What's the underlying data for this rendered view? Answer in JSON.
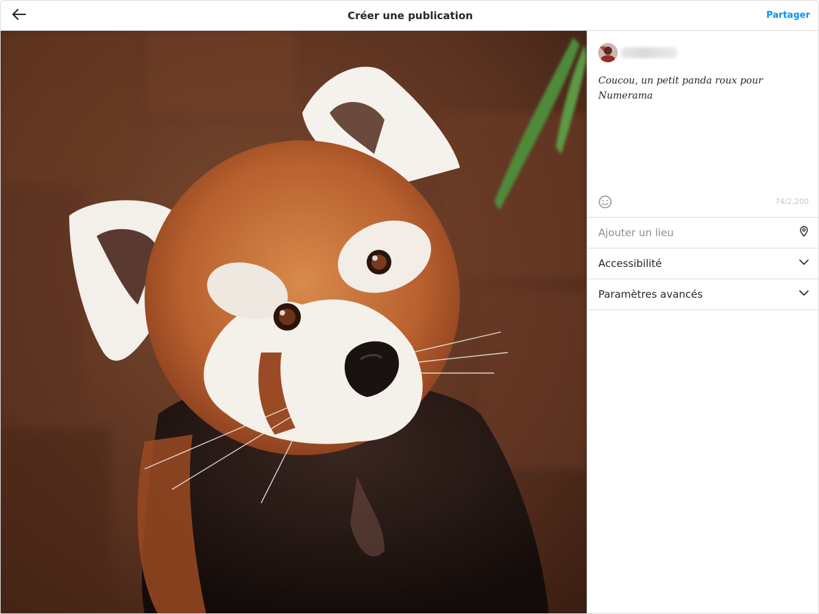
{
  "header": {
    "title": "Créer une publication",
    "share_label": "Partager",
    "back_icon": "arrow-left-icon"
  },
  "photo": {
    "subject": "red panda"
  },
  "composer": {
    "caption": "Coucou, un petit panda roux pour Numerama",
    "char_count": "74/2,200",
    "emoji_icon": "smiley-icon"
  },
  "options": {
    "location_placeholder": "Ajouter un lieu",
    "location_icon": "location-pin-icon",
    "accessibility_label": "Accessibilité",
    "advanced_label": "Paramètres avancés",
    "chevron_icon": "chevron-down-icon"
  },
  "colors": {
    "accent": "#0095f6",
    "border": "#dbdbdb",
    "text": "#262626",
    "muted": "#8e8e8e"
  }
}
